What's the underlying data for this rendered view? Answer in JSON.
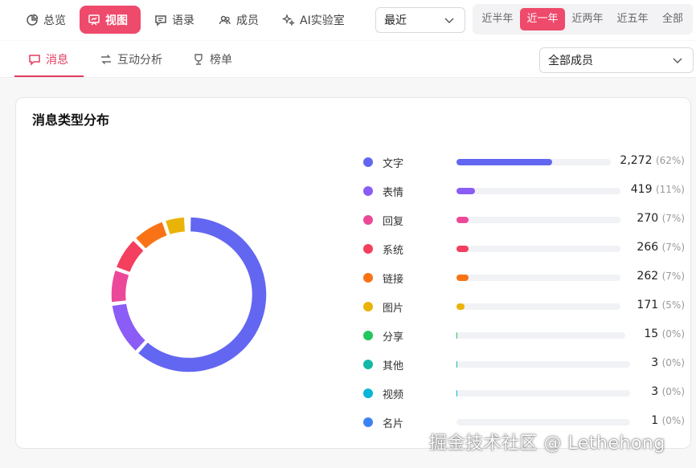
{
  "nav": {
    "items": [
      {
        "label": "总览",
        "icon": "chart-pie-icon",
        "active": false
      },
      {
        "label": "视图",
        "icon": "presentation-icon",
        "active": true
      },
      {
        "label": "语录",
        "icon": "quote-bubble-icon",
        "active": false
      },
      {
        "label": "成员",
        "icon": "members-icon",
        "active": false
      },
      {
        "label": "AI实验室",
        "icon": "sparkle-icon",
        "active": false
      }
    ],
    "period_select": "最近",
    "ranges": [
      {
        "label": "近半年",
        "active": false
      },
      {
        "label": "近一年",
        "active": true
      },
      {
        "label": "近两年",
        "active": false
      },
      {
        "label": "近五年",
        "active": false
      },
      {
        "label": "全部",
        "active": false
      }
    ]
  },
  "subtabs": {
    "items": [
      {
        "label": "消息",
        "icon": "message-icon",
        "active": true
      },
      {
        "label": "互动分析",
        "icon": "swap-icon",
        "active": false
      },
      {
        "label": "榜单",
        "icon": "trophy-icon",
        "active": false
      }
    ],
    "member_select": "全部成员"
  },
  "card": {
    "title": "消息类型分布"
  },
  "chart_data": {
    "type": "pie",
    "variant": "donut",
    "title": "消息类型分布",
    "categories": [
      "文字",
      "表情",
      "回复",
      "系统",
      "链接",
      "图片",
      "分享",
      "其他",
      "视频",
      "名片"
    ],
    "values": [
      2272,
      419,
      270,
      266,
      262,
      171,
      15,
      3,
      3,
      1
    ],
    "percent_labels": [
      "(62%)",
      "(11%)",
      "(7%)",
      "(7%)",
      "(7%)",
      "(5%)",
      "(0%)",
      "(0%)",
      "(0%)",
      "(0%)"
    ],
    "value_labels": [
      "2,272",
      "419",
      "270",
      "266",
      "262",
      "171",
      "15",
      "3",
      "3",
      "1"
    ],
    "colors": [
      "#6366f1",
      "#8b5cf6",
      "#ec4899",
      "#f43f5e",
      "#f97316",
      "#eab308",
      "#22c55e",
      "#14b8a6",
      "#06b6d4",
      "#3b82f6"
    ],
    "legend": "right"
  },
  "watermark": "掘金技术社区 @ Lethehong"
}
